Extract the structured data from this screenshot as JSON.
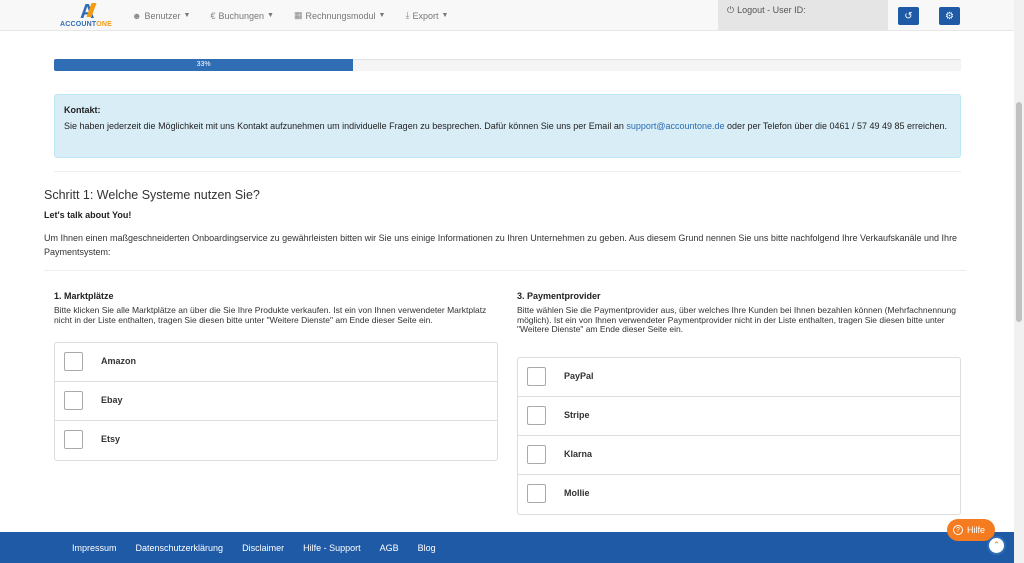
{
  "brand": {
    "mark": "A",
    "word_a": "ACCOUNT",
    "word_b": "ONE"
  },
  "nav": {
    "items": [
      {
        "label": "Benutzer",
        "icon": "user-icon"
      },
      {
        "label": "Buchungen",
        "icon": "euro-icon"
      },
      {
        "label": "Rechnungsmodul",
        "icon": "table-icon"
      },
      {
        "label": "Export",
        "icon": "export-icon"
      }
    ],
    "logout_label": "Logout - User ID:"
  },
  "progress": {
    "value": 0.33,
    "label": "33%"
  },
  "contact": {
    "heading": "Kontakt:",
    "text_before": "Sie haben jederzeit die Möglichkeit mit uns Kontakt aufzunehmen um individuelle Fragen zu besprechen. Dafür können Sie uns per Email an ",
    "email": "support@accountone.de",
    "text_after": " oder per Telefon über die 0461 / 57 49 49 85 erreichen."
  },
  "step": {
    "title": "Schritt 1: Welche Systeme nutzen Sie?",
    "subtitle": "Let's talk about You!",
    "intro": "Um Ihnen einen maßgeschneiderten Onboardingservice zu gewährleisten bitten wir Sie uns einige Informationen zu Ihren Unternehmen zu geben. Aus diesem Grund nennen Sie uns bitte nachfolgend Ihre Verkaufskanäle und Ihre Paymentsystem:"
  },
  "marketplaces": {
    "title": "1. Marktplätze",
    "desc": "Bitte klicken Sie alle Marktplätze an über die Sie Ihre Produkte verkaufen. Ist ein von Ihnen verwendeter Marktplatz nicht in der Liste enthalten, tragen Sie diesen bitte unter \"Weitere Dienste\" am Ende dieser Seite ein.",
    "items": [
      "Amazon",
      "Ebay",
      "Etsy"
    ]
  },
  "payment": {
    "title": "3. Paymentprovider",
    "desc": "Bitte wählen Sie die Paymentprovider aus, über welches Ihre Kunden bei Ihnen bezahlen können (Mehrfachnennung möglich). Ist ein von Ihnen verwendeter Paymentprovider nicht in der Liste enthalten, tragen Sie diesen bitte unter \"Weitere Dienste\" am Ende dieser Seite ein.",
    "items": [
      "PayPal",
      "Stripe",
      "Klarna",
      "Mollie"
    ]
  },
  "footer": {
    "links": [
      "Impressum",
      "Datenschutzerklärung",
      "Disclaimer",
      "Hilfe - Support",
      "AGB",
      "Blog"
    ]
  },
  "help": {
    "label": "Hilfe"
  },
  "colors": {
    "brand_blue": "#1f5aa6",
    "accent_orange": "#f47b20",
    "info_bg": "#d9edf7"
  }
}
